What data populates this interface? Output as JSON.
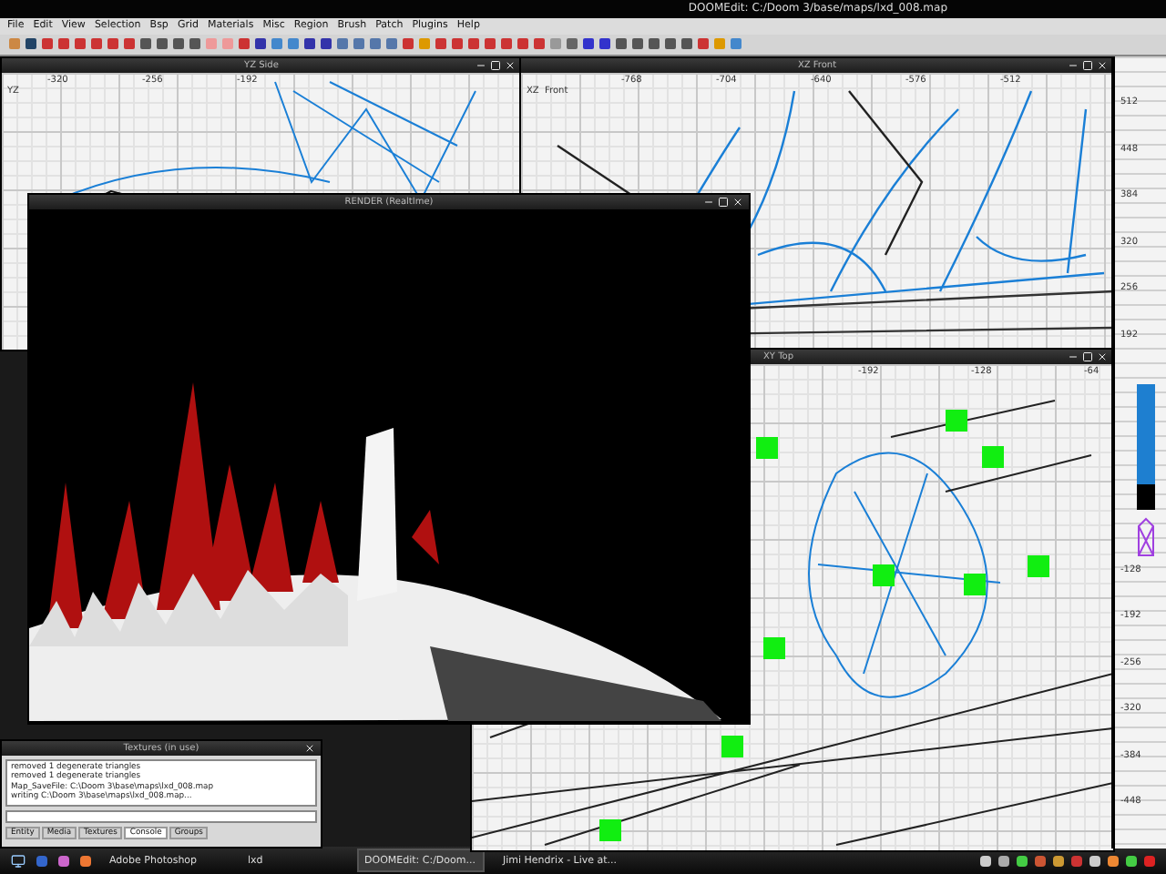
{
  "title_bar": {
    "title": "DOOMEdit: C:/Doom 3/base/maps/lxd_008.map"
  },
  "menu": [
    "File",
    "Edit",
    "View",
    "Selection",
    "Bsp",
    "Grid",
    "Materials",
    "Misc",
    "Region",
    "Brush",
    "Patch",
    "Plugins",
    "Help"
  ],
  "views": [
    {
      "kind": "side",
      "title": "YZ Side",
      "axis_label": "YZ",
      "ticks": [
        "-320",
        "-256",
        "-192"
      ]
    },
    {
      "kind": "front",
      "title": "XZ Front",
      "axis_label": "XZ  Front",
      "ticks": [
        "-768",
        "-704",
        "-640",
        "-576",
        "-512"
      ]
    },
    {
      "kind": "top",
      "title": "XY Top",
      "ticks": [
        "-192",
        "-128",
        "-64"
      ]
    }
  ],
  "z_ruler": {
    "upper_ticks": [
      "512",
      "448",
      "384",
      "320",
      "256",
      "192"
    ],
    "lower_ticks": [
      "-128",
      "-192",
      "-256",
      "-320",
      "-384",
      "-448"
    ]
  },
  "render": {
    "title": "RENDER (RealtIme)"
  },
  "console": {
    "title": "Textures (in use)",
    "lines": [
      "removed 1 degenerate triangles",
      "removed 1 degenerate triangles",
      "Map_SaveFile: C:\\Doom 3\\base\\maps\\lxd_008.map",
      "writing C:\\Doom 3\\base\\maps\\lxd_008.map..."
    ],
    "tabs": [
      {
        "label": "Entity",
        "selected": false
      },
      {
        "label": "Media",
        "selected": false
      },
      {
        "label": "Textures",
        "selected": false
      },
      {
        "label": "Console",
        "selected": true
      },
      {
        "label": "Groups",
        "selected": false
      }
    ]
  },
  "taskbar": {
    "tasks": [
      {
        "label": "Adobe Photoshop",
        "selected": false
      },
      {
        "label": "lxd",
        "selected": false
      },
      {
        "label": "DOOMEdit: C:/Doom...",
        "selected": true
      },
      {
        "label": "Jimi Hendrix - Live at...",
        "selected": false
      }
    ]
  }
}
